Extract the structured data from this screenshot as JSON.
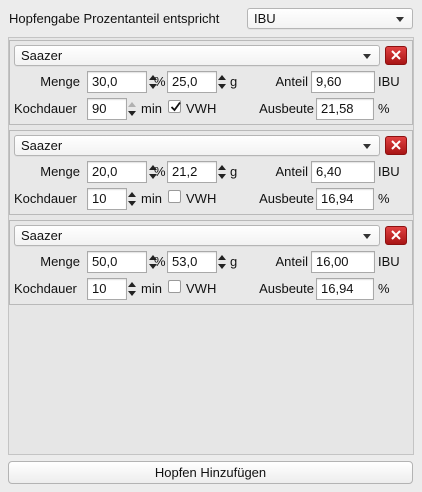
{
  "header": {
    "label": "Hopfengabe Prozentanteil entspricht",
    "select_value": "IBU"
  },
  "labels": {
    "menge": "Menge",
    "anteil": "Anteil",
    "kochdauer": "Kochdauer",
    "ausbeute": "Ausbeute",
    "percent": "%",
    "gram": "g",
    "ibu_unit": "IBU",
    "min": "min",
    "vwh": "VWH"
  },
  "hops": [
    {
      "variety": "Saazer",
      "percent": "30,0",
      "grams": "25,0",
      "anteil": "9,60",
      "kochdauer": "90",
      "vwh": true,
      "ausbeute": "21,58"
    },
    {
      "variety": "Saazer",
      "percent": "20,0",
      "grams": "21,2",
      "anteil": "6,40",
      "kochdauer": "10",
      "vwh": false,
      "ausbeute": "16,94"
    },
    {
      "variety": "Saazer",
      "percent": "50,0",
      "grams": "53,0",
      "anteil": "16,00",
      "kochdauer": "10",
      "vwh": false,
      "ausbeute": "16,94"
    }
  ],
  "footer": {
    "add_button": "Hopfen Hinzufügen"
  },
  "colors": {
    "delete_button": "#c62828",
    "field_border": "#a9a9a9"
  }
}
